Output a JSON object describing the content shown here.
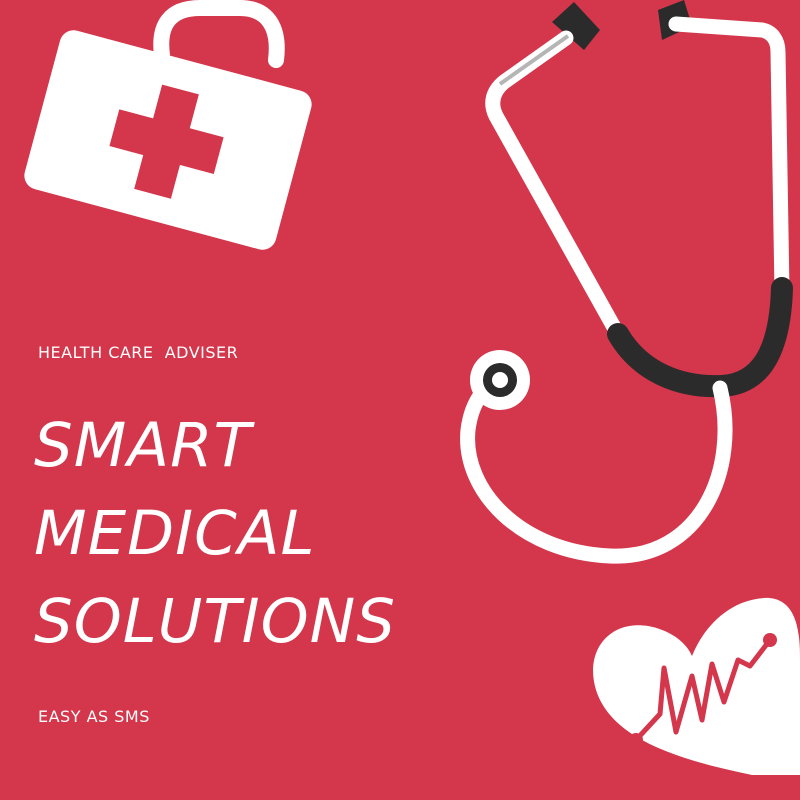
{
  "colors": {
    "background": "#d4364b",
    "foreground": "#ffffff",
    "dark": "#2b2b2b"
  },
  "icons": [
    "first-aid-kit-icon",
    "stethoscope-icon",
    "heart-pulse-icon"
  ],
  "text": {
    "subtitle": "HEALTH CARE  ADVISER",
    "headline": [
      "SMART",
      "MEDICAL",
      "SOLUTIONS"
    ],
    "tagline": "EASY AS SMS"
  }
}
